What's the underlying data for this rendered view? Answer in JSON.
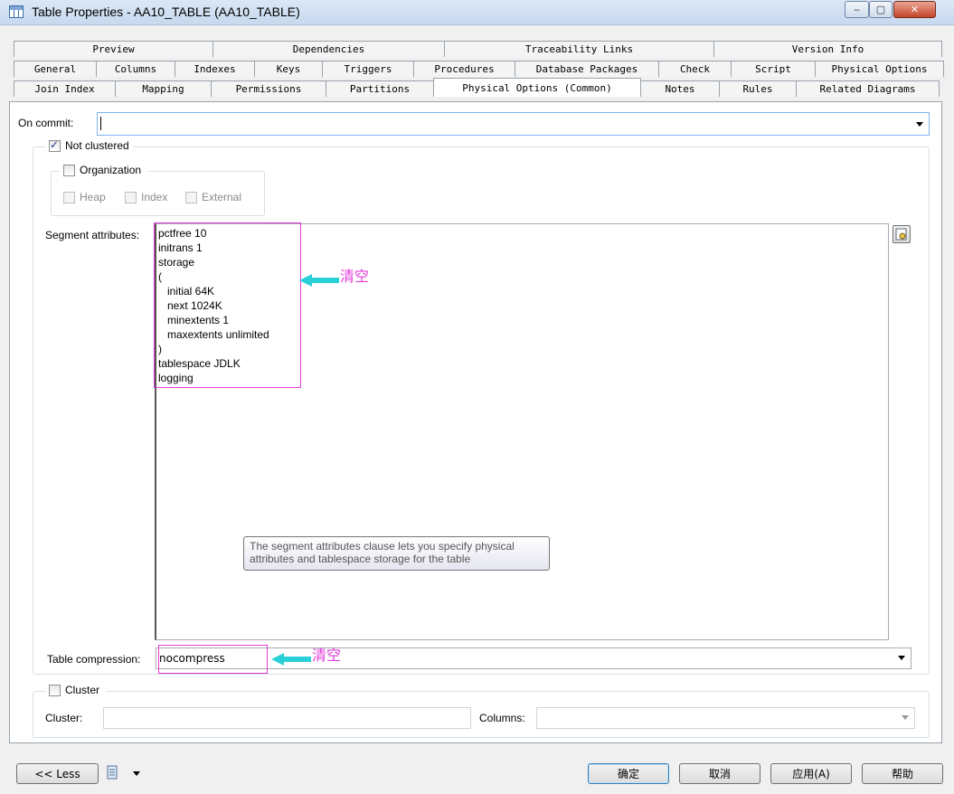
{
  "window": {
    "title": "Table Properties - AA10_TABLE (AA10_TABLE)",
    "minimize": "‒",
    "maximize": "▢",
    "close": "✕"
  },
  "tabs": {
    "row1": [
      "Preview",
      "Dependencies",
      "Traceability Links",
      "Version Info"
    ],
    "row2": [
      "General",
      "Columns",
      "Indexes",
      "Keys",
      "Triggers",
      "Procedures",
      "Database Packages",
      "Check",
      "Script",
      "Physical Options"
    ],
    "row3": [
      "Join Index",
      "Mapping",
      "Permissions",
      "Partitions",
      "Physical Options (Common)",
      "Notes",
      "Rules",
      "Related Diagrams"
    ],
    "active": "Physical Options (Common)"
  },
  "form": {
    "on_commit_label": "On commit:",
    "on_commit_value": "",
    "not_clustered_label": "Not clustered",
    "not_clustered_checked": true,
    "organization_label": "Organization",
    "heap_label": "Heap",
    "index_label": "Index",
    "external_label": "External",
    "segment_label": "Segment attributes:",
    "segment_text": "pctfree 10\ninitrans 1\nstorage\n(\n   initial 64K\n   next 1024K\n   minextents 1\n   maxextents unlimited\n)\ntablespace JDLK\nlogging",
    "tooltip": "The segment attributes clause lets you specify physical\nattributes and tablespace storage for the table",
    "compression_label": "Table compression:",
    "compression_value": "nocompress",
    "cluster_group_label": "Cluster",
    "cluster_label": "Cluster:",
    "columns_label": "Columns:"
  },
  "annotations": {
    "segment_note": "清空",
    "compression_note": "清空",
    "color": "#e23bd9",
    "arrow_color": "#2ad0d8"
  },
  "footer": {
    "less_button": "<< Less",
    "ok_button": "确定",
    "cancel_button": "取消",
    "apply_button": "应用(A)",
    "help_button": "帮助"
  }
}
